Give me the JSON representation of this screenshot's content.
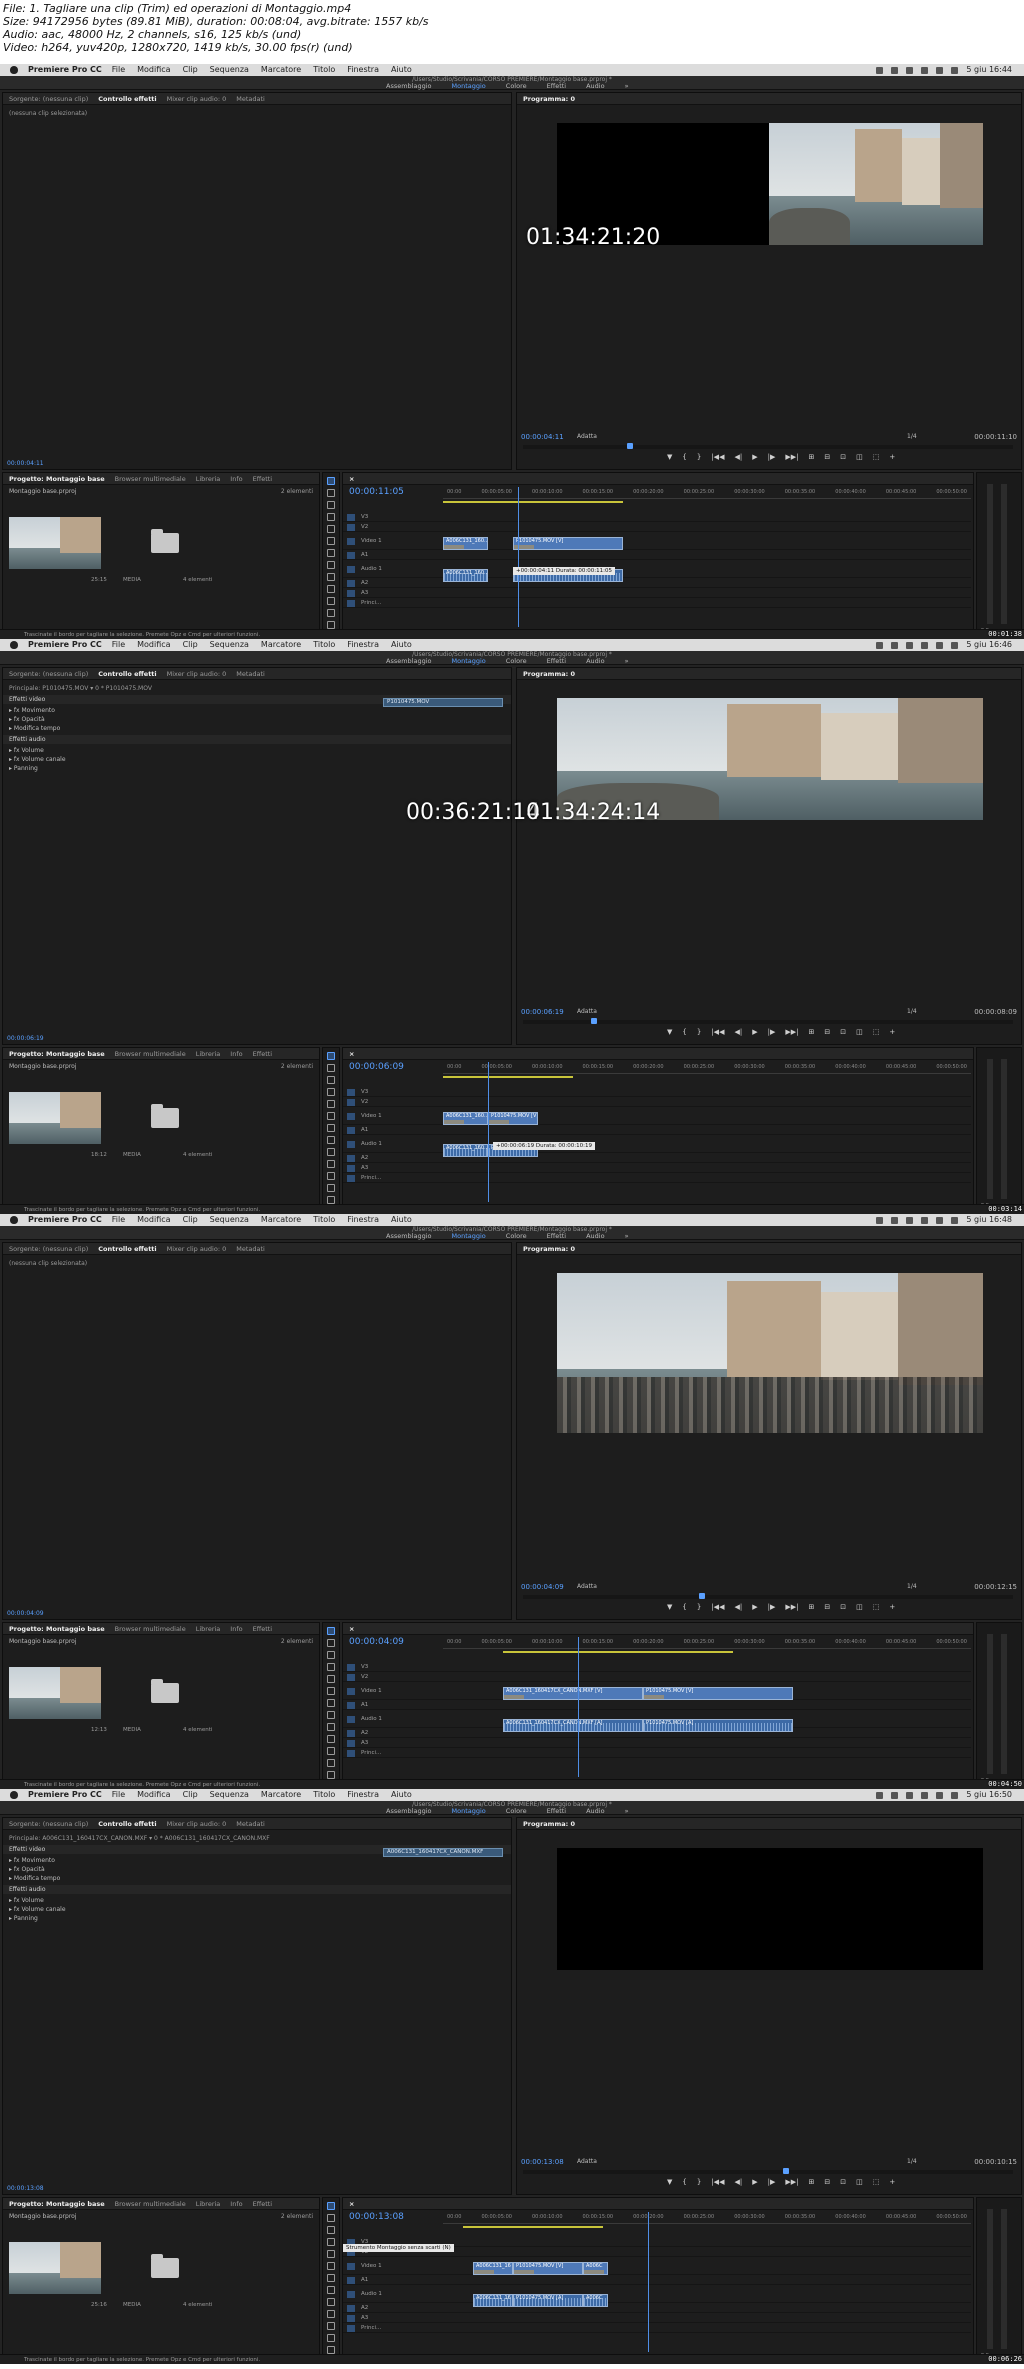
{
  "header": {
    "line1": "File: 1. Tagliare una clip (Trim) ed operazioni di Montaggio.mp4",
    "line2": "Size: 94172956 bytes (89.81 MiB), duration: 00:08:04, avg.bitrate: 1557 kb/s",
    "line3": "Audio: aac, 48000 Hz, 2 channels, s16, 125 kb/s (und)",
    "line4": "Video: h264, yuv420p, 1280x720, 1419 kb/s, 30.00 fps(r) (und)"
  },
  "menubar": {
    "app": "Premiere Pro CC",
    "items": [
      "File",
      "Modifica",
      "Clip",
      "Sequenza",
      "Marcatore",
      "Titolo",
      "Finestra",
      "Aiuto"
    ]
  },
  "workspace": {
    "path": "/Users/Studio/Scrivania/CORSO PREMIERE/Montaggio base.prproj *",
    "tabs": [
      "Assemblaggio",
      "Montaggio",
      "Colore",
      "Effetti",
      "Audio",
      "»"
    ]
  },
  "effect_panel_tabs": [
    "Sorgente: (nessuna clip)",
    "Controllo effetti",
    "Mixer clip audio: 0",
    "Metadati"
  ],
  "program": {
    "label": "Programma: 0",
    "fit": "Adatta",
    "quality": "1/4",
    "transport": [
      "▼",
      "{",
      "}",
      "|◀◀",
      "◀|",
      "▶",
      "|▶",
      "▶▶|",
      "⊞",
      "⊟",
      "⊡",
      "◫",
      "⬚",
      "+"
    ]
  },
  "project": {
    "tabs": [
      "Progetto: Montaggio base",
      "Browser multimediale",
      "Libreria",
      "Info",
      "Effetti"
    ],
    "file": "Montaggio base.prproj",
    "count": "2 elementi",
    "media_label": "MEDIA",
    "media_count": "4 elementi"
  },
  "timeline": {
    "tracks": [
      "V3",
      "V2",
      "Video 1",
      "A1",
      "Audio 1",
      "A2",
      "A3",
      "Princi..."
    ],
    "ruler_labels": [
      "00:00",
      "00:00:05:00",
      "00:00:10:00",
      "00:00:15:00",
      "00:00:20:00",
      "00:00:25:00",
      "00:00:30:00",
      "00:00:35:00",
      "00:00:40:00",
      "00:00:45:00",
      "00:00:50:00"
    ],
    "meters_label": "S  S"
  },
  "status_text": "Trascinate il bordo per tagliare la selezione. Premete Opz e Cmd per ulteriori funzioni.",
  "frames": [
    {
      "clock": "5 giu 16:44",
      "fx_title": "(nessuna clip selezionata)",
      "fx_clip": "",
      "program_tc_left": "00:00:04:11",
      "program_tc_right": "00:00:11:10",
      "overlay_left": "",
      "overlay_right": "01:34:21:20",
      "timeline_tc": "00:00:11:05",
      "thumb_duration": "25:15",
      "clips": [
        {
          "name": "A006C131_160...",
          "track": "v"
        },
        {
          "name": "P1010475.MOV [V]",
          "track": "v"
        },
        {
          "name": "A006C131_160...",
          "track": "a"
        },
        {
          "name": "P1010475.MOV [A]",
          "track": "a"
        }
      ],
      "tooltip": "+00:00:04:11  Durata: 00:00:11:05",
      "stamp": "00:01:38"
    },
    {
      "clock": "5 giu 16:46",
      "fx_title": "Principale: P1010475.MOV  ▾  0 * P1010475.MOV",
      "fx_clip": "P1010475.MOV",
      "program_tc_left": "00:00:06:19",
      "program_tc_right": "00:00:08:09",
      "overlay_left": "00:36:21:14",
      "overlay_right": "01:34:24:14",
      "timeline_tc": "00:00:06:09",
      "thumb_duration": "18:12",
      "clips": [
        {
          "name": "A006C131_160...",
          "track": "v"
        },
        {
          "name": "P1010475.MOV [V]",
          "track": "v"
        },
        {
          "name": "A006C131_160...",
          "track": "a"
        },
        {
          "name": "P1010475.MOV [A]",
          "track": "a"
        }
      ],
      "tooltip": "+00:00:06:19  Durata: 00:00:10:19",
      "stamp": "00:03:14"
    },
    {
      "clock": "5 giu 16:48",
      "fx_title": "(nessuna clip selezionata)",
      "fx_clip": "",
      "program_tc_left": "00:00:04:09",
      "program_tc_right": "00:00:12:15",
      "overlay_left": "",
      "overlay_right": "",
      "timeline_tc": "00:00:04:09",
      "thumb_duration": "12:13",
      "clips": [
        {
          "name": "A006C131_160417CX_CANON.MXF [V]",
          "track": "v"
        },
        {
          "name": "P1010475.MOV [V]",
          "track": "v"
        },
        {
          "name": "A006C131_160417CX_CANON.MXF [A]",
          "track": "a"
        },
        {
          "name": "P1010475.MOV [A]",
          "track": "a"
        }
      ],
      "tooltip": "",
      "stamp": "00:04:50"
    },
    {
      "clock": "5 giu 16:50",
      "fx_title": "Principale: A006C131_160417CX_CANON.MXF  ▾  0 * A006C131_160417CX_CANON.MXF",
      "fx_clip": "A006C131_160417CX_CANON.MXF",
      "program_tc_left": "00:00:13:08",
      "program_tc_right": "00:00:10:15",
      "overlay_left": "",
      "overlay_right": "",
      "timeline_tc": "00:00:13:08",
      "thumb_duration": "25:16",
      "clips": [
        {
          "name": "A006C131_16",
          "track": "v"
        },
        {
          "name": "P1010475.MOV [V]",
          "track": "v"
        },
        {
          "name": "A006C",
          "track": "v"
        },
        {
          "name": "A006C131_16",
          "track": "a"
        },
        {
          "name": "P1010475.MOV [A]",
          "track": "a"
        },
        {
          "name": "A006C",
          "track": "a"
        }
      ],
      "tooltip": "Strumento Montaggio senza scarti (N)",
      "stamp": "00:06:26"
    }
  ]
}
